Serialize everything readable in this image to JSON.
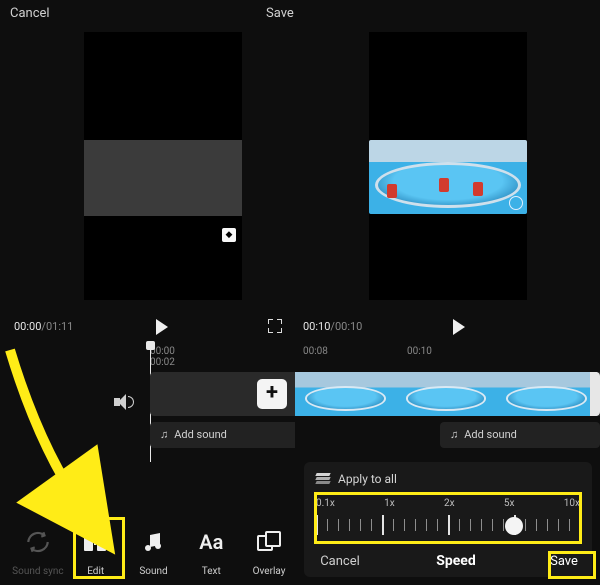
{
  "header": {
    "cancel": "Cancel",
    "save": "Save"
  },
  "left": {
    "time_current": "00:00",
    "time_total": "01:11",
    "ruler": [
      "00:00",
      "00:02"
    ],
    "add_sound": "Add sound",
    "tools": {
      "sync": "Sound sync",
      "edit": "Edit",
      "sound": "Sound",
      "text": "Text",
      "overlay": "Overlay"
    }
  },
  "right": {
    "time_current": "00:10",
    "time_total": "00:10",
    "ruler": [
      "00:08",
      "00:10"
    ],
    "add_sound": "Add sound"
  },
  "speed": {
    "apply_all": "Apply to all",
    "labels": [
      "0.1x",
      "1x",
      "2x",
      "5x",
      "10x"
    ],
    "cancel": "Cancel",
    "title": "Speed",
    "save": "Save",
    "knob_position_pct": 75
  },
  "icons": {
    "play": "play-icon",
    "fullscreen": "fullscreen-icon",
    "speaker": "speaker-icon",
    "plus": "+",
    "note": "♫",
    "text_glyph": "Aa"
  }
}
